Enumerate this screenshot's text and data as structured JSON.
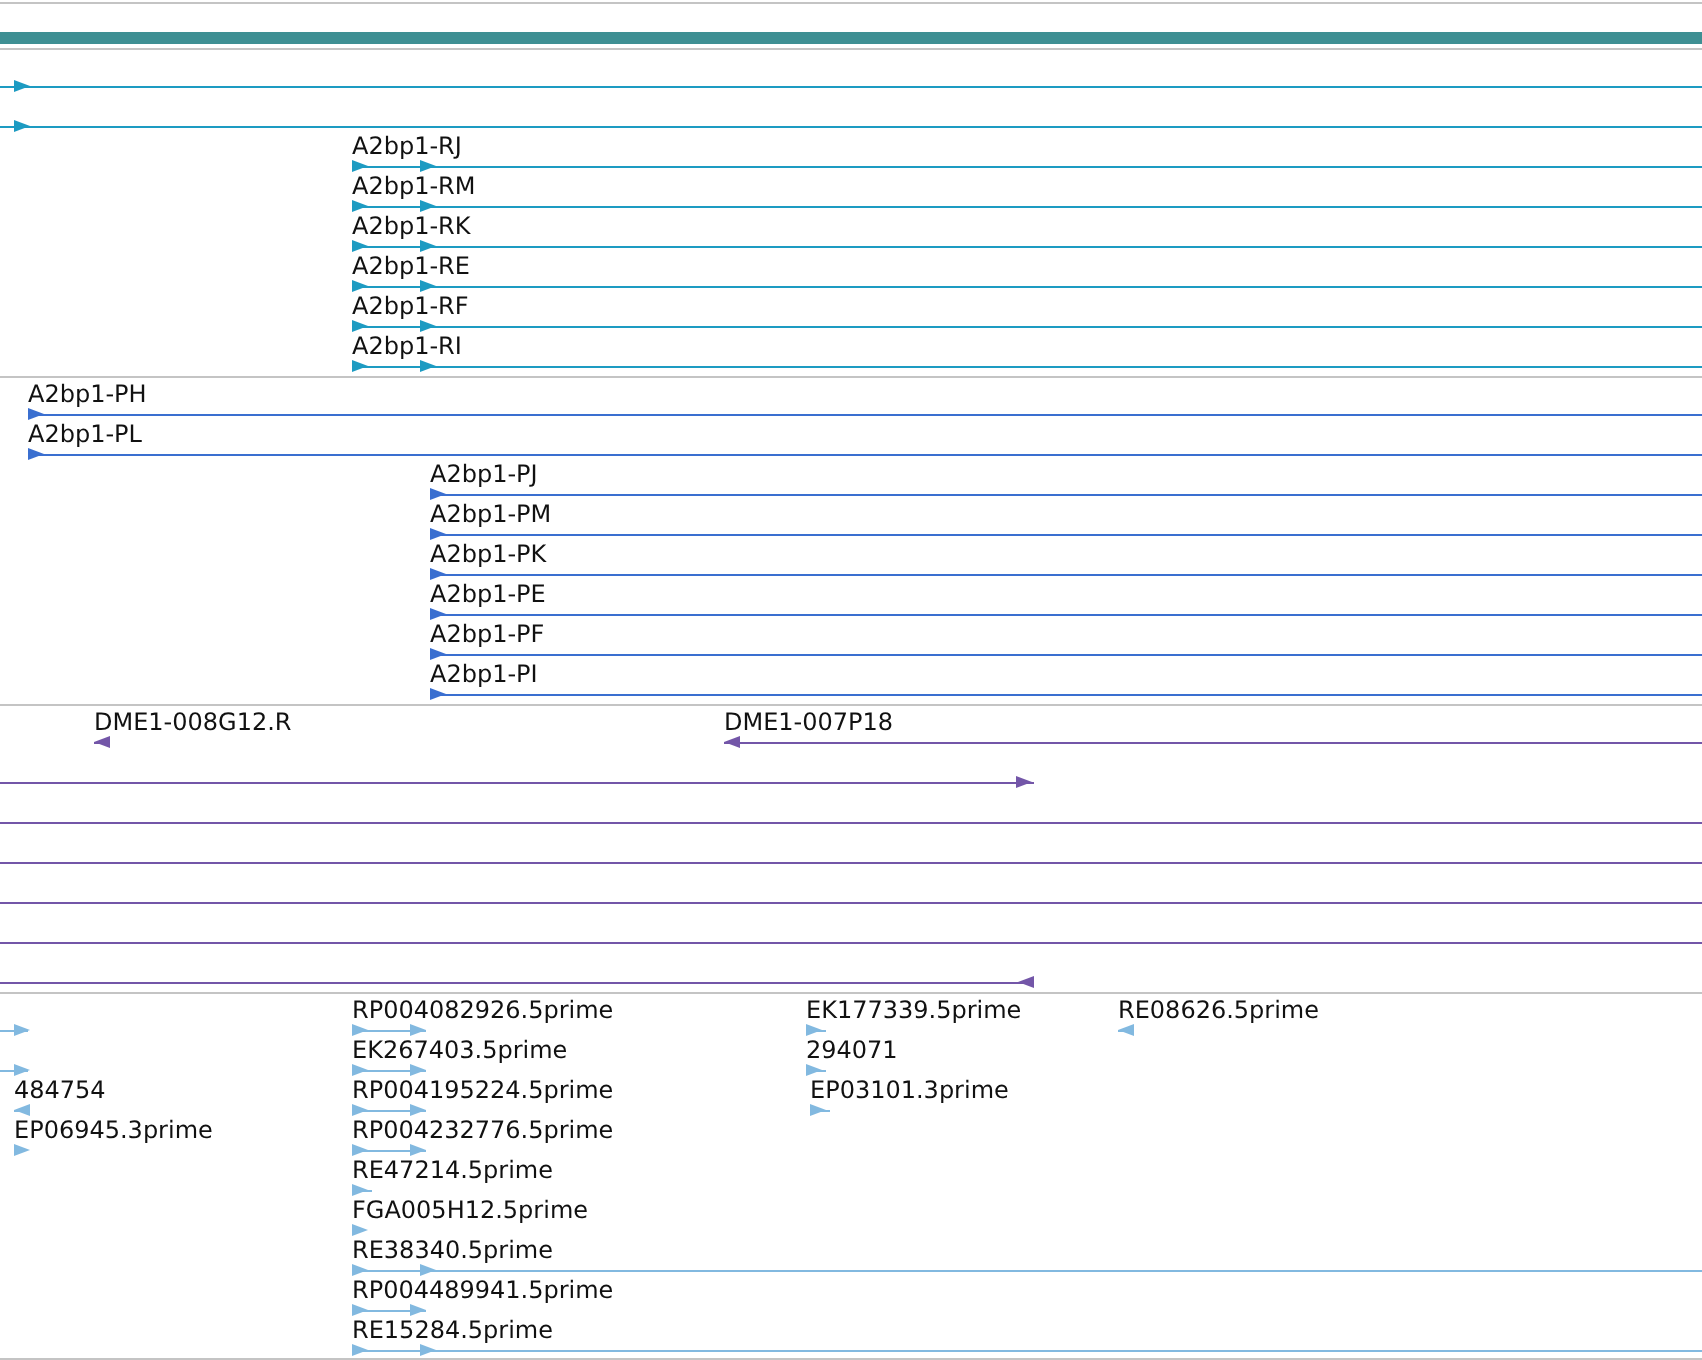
{
  "tracks": [
    {
      "color": "#1d9bc2",
      "features": [
        {
          "kind": "forward"
        },
        {
          "kind": "forward"
        },
        {
          "label": "A2bp1-RJ",
          "kind": "forward"
        },
        {
          "label": "A2bp1-RM",
          "kind": "forward"
        },
        {
          "label": "A2bp1-RK",
          "kind": "forward"
        },
        {
          "label": "A2bp1-RE",
          "kind": "forward"
        },
        {
          "label": "A2bp1-RF",
          "kind": "forward"
        },
        {
          "label": "A2bp1-RI",
          "kind": "forward"
        }
      ]
    },
    {
      "color": "#3a6fd0",
      "features": [
        {
          "label": "A2bp1-PH",
          "kind": "forward"
        },
        {
          "label": "A2bp1-PL",
          "kind": "forward"
        },
        {
          "label": "A2bp1-PJ",
          "kind": "forward"
        },
        {
          "label": "A2bp1-PM",
          "kind": "forward"
        },
        {
          "label": "A2bp1-PK",
          "kind": "forward"
        },
        {
          "label": "A2bp1-PE",
          "kind": "forward"
        },
        {
          "label": "A2bp1-PF",
          "kind": "forward"
        },
        {
          "label": "A2bp1-PI",
          "kind": "forward"
        }
      ]
    },
    {
      "color": "#7356a8",
      "features": [
        {
          "label": "DME1-008G12.R",
          "kind": "reverse"
        },
        {
          "label": "DME1-007P18",
          "kind": "reverse"
        },
        {
          "kind": "forward"
        },
        {
          "kind": "line"
        },
        {
          "kind": "line"
        },
        {
          "kind": "line"
        },
        {
          "kind": "line"
        },
        {
          "kind": "reverse"
        }
      ]
    },
    {
      "color": "#82b9e0",
      "features": [
        {
          "kind": "forward"
        },
        {
          "kind": "forward"
        },
        {
          "label": "484754",
          "kind": "reverse"
        },
        {
          "label": "EP06945.3prime",
          "kind": "forward"
        },
        {
          "label": "RP004082926.5prime",
          "kind": "forward"
        },
        {
          "label": "EK267403.5prime",
          "kind": "forward"
        },
        {
          "label": "RP004195224.5prime",
          "kind": "forward"
        },
        {
          "label": "RP004232776.5prime",
          "kind": "forward"
        },
        {
          "label": "RE47214.5prime",
          "kind": "forward"
        },
        {
          "label": "FGA005H12.5prime",
          "kind": "forward"
        },
        {
          "label": "RE38340.5prime",
          "kind": "forward"
        },
        {
          "label": "RP004489941.5prime",
          "kind": "forward"
        },
        {
          "label": "RE15284.5prime",
          "kind": "forward"
        },
        {
          "label": "EK177339.5prime",
          "kind": "forward"
        },
        {
          "label": "294071",
          "kind": "forward"
        },
        {
          "label": "EP03101.3prime",
          "kind": "forward"
        },
        {
          "label": "RE08626.5prime",
          "kind": "reverse"
        }
      ]
    }
  ]
}
